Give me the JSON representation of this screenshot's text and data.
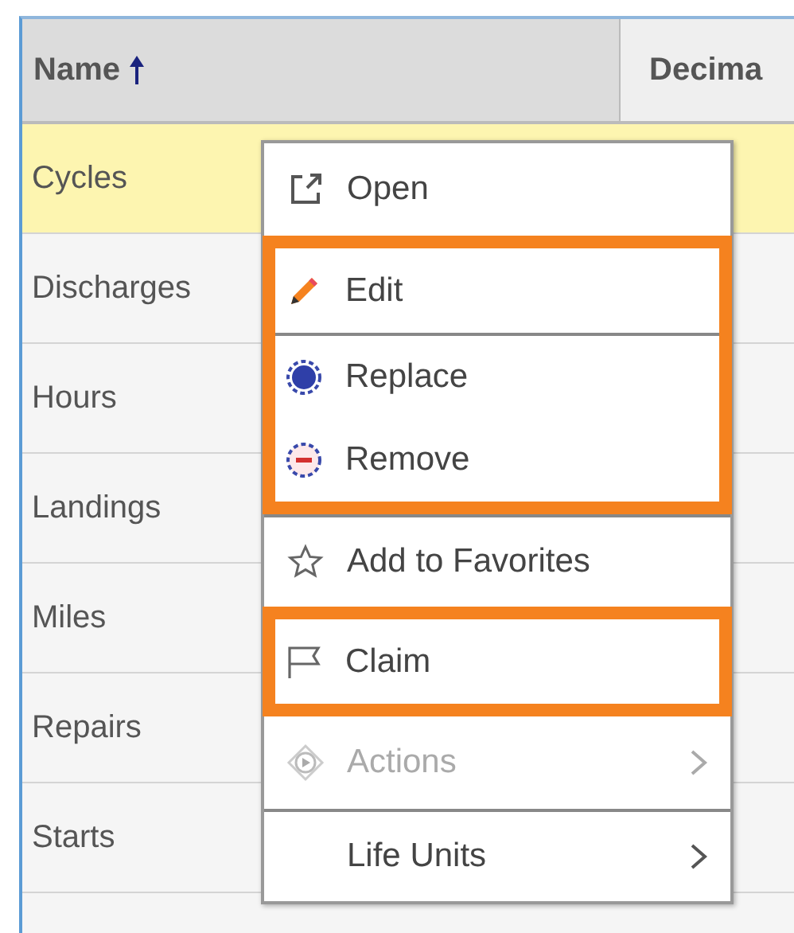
{
  "table": {
    "columns": [
      {
        "label": "Name",
        "sorted": true
      },
      {
        "label": "Decima",
        "sorted": false
      }
    ],
    "rows": [
      {
        "name": "Cycles",
        "selected": true
      },
      {
        "name": "Discharges",
        "selected": false
      },
      {
        "name": "Hours",
        "selected": false
      },
      {
        "name": "Landings",
        "selected": false
      },
      {
        "name": "Miles",
        "selected": false
      },
      {
        "name": "Repairs",
        "selected": false
      },
      {
        "name": "Starts",
        "selected": false
      }
    ]
  },
  "context_menu": {
    "sections": [
      {
        "highlighted": false,
        "items": [
          {
            "label": "Open",
            "kind": "open",
            "disabled": false,
            "submenu": false,
            "separated": false
          }
        ]
      },
      {
        "highlighted": true,
        "items": [
          {
            "label": "Edit",
            "kind": "edit",
            "disabled": false,
            "submenu": false,
            "separated": false
          },
          {
            "label": "Replace",
            "kind": "replace",
            "disabled": false,
            "submenu": false,
            "separated": true
          },
          {
            "label": "Remove",
            "kind": "remove",
            "disabled": false,
            "submenu": false,
            "separated": false
          }
        ]
      },
      {
        "highlighted": false,
        "items": [
          {
            "label": "Add to Favorites",
            "kind": "star",
            "disabled": false,
            "submenu": false,
            "separated": true
          }
        ]
      },
      {
        "highlighted": true,
        "items": [
          {
            "label": "Claim",
            "kind": "flag",
            "disabled": false,
            "submenu": false,
            "separated": false
          }
        ]
      },
      {
        "highlighted": false,
        "items": [
          {
            "label": "Actions",
            "kind": "play",
            "disabled": true,
            "submenu": true,
            "separated": false
          },
          {
            "label": "Life Units",
            "kind": "plain",
            "disabled": false,
            "submenu": true,
            "separated": true
          }
        ]
      }
    ]
  }
}
